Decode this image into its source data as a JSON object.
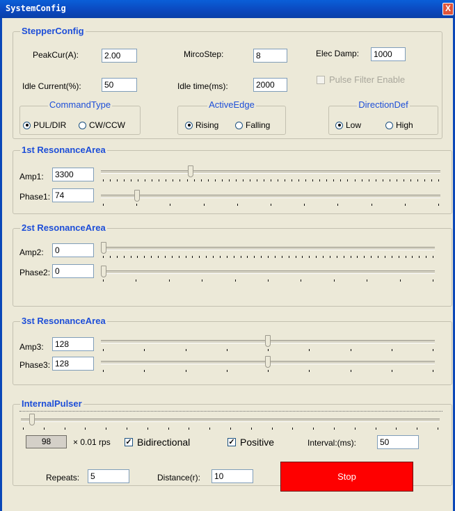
{
  "window": {
    "title": "SystemConfig",
    "close_glyph": "X"
  },
  "stepper": {
    "legend": "StepperConfig",
    "peak_label": "PeakCur(A):",
    "peak_value": "2.00",
    "micro_label": "MircoStep:",
    "micro_value": "8",
    "damp_label": "Elec Damp:",
    "damp_value": "1000",
    "idle_label": "Idle Current(%):",
    "idle_value": "50",
    "idletime_label": "Idle time(ms):",
    "idletime_value": "2000",
    "pulse_filter_label": "Pulse Filter Enable",
    "pulse_filter_checked": false,
    "command": {
      "legend": "CommandType",
      "opt1": "PUL/DIR",
      "opt2": "CW/CCW",
      "selected": "PUL/DIR"
    },
    "edge": {
      "legend": "ActiveEdge",
      "opt1": "Rising",
      "opt2": "Falling",
      "selected": "Rising"
    },
    "direction": {
      "legend": "DirectionDef",
      "opt1": "Low",
      "opt2": "High",
      "selected": "Low"
    }
  },
  "res1": {
    "legend": "1st ResonanceArea",
    "amp_label": "Amp1:",
    "amp_value": "3300",
    "phase_label": "Phase1:",
    "phase_value": "74",
    "amp_level": 0.26,
    "phase_level": 0.1
  },
  "res2": {
    "legend": "2st ResonanceArea",
    "amp_label": "Amp2:",
    "amp_value": "0",
    "phase_label": "Phase2:",
    "phase_value": "0",
    "amp_level": 0.0,
    "phase_level": 0.0
  },
  "res3": {
    "legend": "3st ResonanceArea",
    "amp_label": "Amp3:",
    "amp_value": "128",
    "phase_label": "Phase3:",
    "phase_value": "128",
    "amp_level": 0.5,
    "phase_level": 0.5
  },
  "pulser": {
    "legend": "InternalPulser",
    "speed_value": "98",
    "speed_unit": "× 0.01 rps",
    "speed_level": 0.02,
    "bidirectional_label": "Bidirectional",
    "bidirectional_checked": true,
    "positive_label": "Positive",
    "positive_checked": true,
    "interval_label": "Interval:(ms):",
    "interval_value": "50",
    "repeats_label": "Repeats:",
    "repeats_value": "5",
    "distance_label": "Distance(r):",
    "distance_value": "10",
    "stop_label": "Stop"
  },
  "colors": {
    "stop_button": "#fe0000",
    "legend_text": "#1d4ed8",
    "titlebar": "#0b47bd"
  }
}
